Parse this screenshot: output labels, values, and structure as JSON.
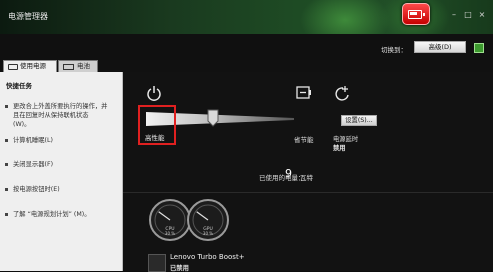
{
  "window": {
    "title": "电源管理器",
    "minimize": "–",
    "maximize": "□",
    "close": "×",
    "battery_badge_icon": "battery-icon"
  },
  "toolbar": {
    "switch_label": "切换到：",
    "plan_select_value": "高级(D)",
    "status_icon": "green-square-icon"
  },
  "tabs": [
    {
      "label": "使用电源",
      "icon": "plug-icon",
      "active": true
    },
    {
      "label": "电池",
      "icon": "battery-icon",
      "active": false
    }
  ],
  "quick_tasks": {
    "title": "快捷任务",
    "items": [
      {
        "lines": [
          "更改合上外盖所要执行的操作，并",
          "且在回复时从保持联机状态",
          "(W)。"
        ]
      },
      {
        "lines": [
          "计算机睡眠(L)"
        ]
      },
      {
        "lines": [
          "关闭显示器(F)"
        ]
      },
      {
        "lines": [
          "按电源按钮时(E)"
        ]
      },
      {
        "lines": [
          "了解 “电源规划计划” (M)。"
        ]
      }
    ]
  },
  "plans": {
    "high_performance": {
      "label": "高性能",
      "icon": "power-icon"
    },
    "battery_saver": {
      "label": "省节能",
      "icon": "battery-saver-icon"
    },
    "slider_level": 0.45,
    "settings_button": "设置(S)...",
    "sleep": {
      "icon": "sleep-icon",
      "title": "电源延时",
      "value": "禁用"
    }
  },
  "usage": {
    "label": "已使用的电量：",
    "value": "9",
    "unit": "瓦特"
  },
  "gauges": [
    {
      "name": "CPU",
      "value": "30 %",
      "level": 0.3
    },
    {
      "name": "GPU",
      "value": "30 %",
      "level": 0.3
    }
  ],
  "lenovo": {
    "title": "Lenovo Turbo Boost+",
    "subtitle": "已禁用",
    "icon": "turbo-boost-icon"
  },
  "colors": {
    "highlight_box": "#e02020",
    "badge": "#d81515",
    "accent_green": "#3d9a2f"
  }
}
